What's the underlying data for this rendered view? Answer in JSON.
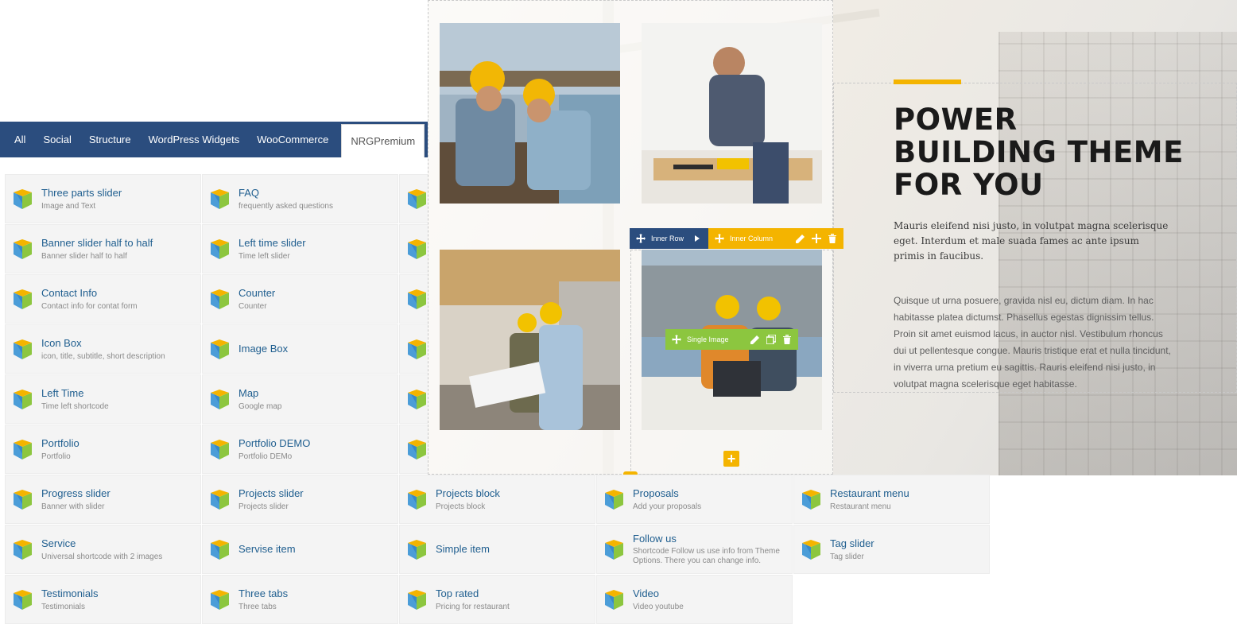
{
  "tabs": [
    {
      "label": "All",
      "active": false
    },
    {
      "label": "Social",
      "active": false
    },
    {
      "label": "Structure",
      "active": false
    },
    {
      "label": "WordPress Widgets",
      "active": false
    },
    {
      "label": "WooCommerce",
      "active": false
    },
    {
      "label": "NRGPremium",
      "active": true
    }
  ],
  "elements": [
    {
      "title": "Three parts slider",
      "desc": "Image and Text"
    },
    {
      "title": "FAQ",
      "desc": "frequently asked questions"
    },
    {
      "title": "Banner slider half to half",
      "desc": "Banner slider half to half"
    },
    {
      "title": "Left time slider",
      "desc": "Time left slider"
    },
    {
      "title": "Contact Info",
      "desc": "Contact info for contat form"
    },
    {
      "title": "Counter",
      "desc": "Counter"
    },
    {
      "title": "Icon Box",
      "desc": "icon, title, subtitle, short description"
    },
    {
      "title": "Image Box",
      "desc": ""
    },
    {
      "title": "Left Time",
      "desc": "Time left shortcode"
    },
    {
      "title": "Map",
      "desc": "Google map"
    },
    {
      "title": "Portfolio",
      "desc": "Portfolio"
    },
    {
      "title": "Portfolio DEMO",
      "desc": "Portfolio DEMo"
    },
    {
      "title": "Progress slider",
      "desc": "Banner with slider"
    },
    {
      "title": "Projects slider",
      "desc": "Projects slider"
    },
    {
      "title": "Projects block",
      "desc": "Projects block"
    },
    {
      "title": "Proposals",
      "desc": "Add your proposals"
    },
    {
      "title": "Restaurant menu",
      "desc": "Restaurant menu"
    },
    {
      "title": "Service",
      "desc": "Universal shortcode with 2 images"
    },
    {
      "title": "Servise item",
      "desc": ""
    },
    {
      "title": "Simple item",
      "desc": ""
    },
    {
      "title": "Follow us",
      "desc": "Shortcode Follow us use info from Theme Options. There you can change info."
    },
    {
      "title": "Tag slider",
      "desc": "Tag slider"
    },
    {
      "title": "Testimonials",
      "desc": "Testimonials"
    },
    {
      "title": "Three tabs",
      "desc": "Three tabs"
    },
    {
      "title": "Top rated",
      "desc": "Pricing for restaurant"
    },
    {
      "title": "Video",
      "desc": "Video youtube"
    }
  ],
  "toolbars": {
    "inner_row": "Inner Row",
    "inner_column": "Inner Column",
    "single_image": "Single Image"
  },
  "hero": {
    "heading_lines": [
      "POWER",
      "BUILDING THEME",
      "FOR YOU"
    ],
    "lead": "Mauris eleifend nisi justo, in volutpat magna scelerisque eget. Interdum et male suada fames ac ante ipsum primis in faucibus.",
    "body": "Quisque ut urna posuere, gravida nisl eu, dictum diam. In hac habitasse platea dictumst. Phasellus egestas dignissim tellus. Proin sit amet euismod lacus, in auctor nisl. Vestibulum rhoncus dui ut pellentesque congue. Mauris tristique erat et nulla tincidunt, in viverra urna pretium eu sagittis. Rauris eleifend nisi justo, in volutpat magna scelerisque eget habitasse."
  },
  "colors": {
    "tab_bar": "#2b4d7e",
    "title_link": "#1f5e8f",
    "row_toolbar": "#2b4d7e",
    "column_toolbar": "#f4b400",
    "element_toolbar": "#8cc63f"
  }
}
